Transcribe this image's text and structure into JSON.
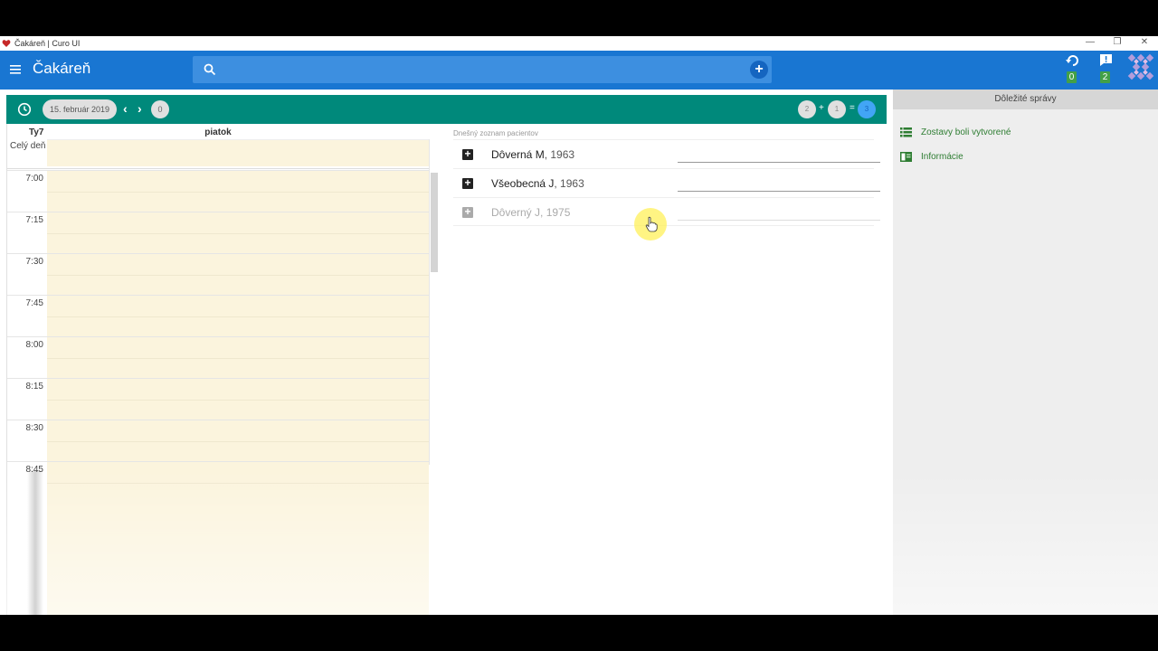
{
  "window": {
    "title": "Čakáreň | Curo UI"
  },
  "appbar": {
    "title": "Čakáreň",
    "search_placeholder": "",
    "sync_badge": "0",
    "messages_badge": "2"
  },
  "toolbar": {
    "date": "15. február 2019",
    "prev_label": "‹",
    "next_label": "›",
    "zero_chip": "0",
    "counts": {
      "a": "2",
      "b": "1",
      "total": "3"
    },
    "plus_op": "+",
    "equals_op": "="
  },
  "calendar": {
    "week_label": "Ty7",
    "day_label": "piatok",
    "allday_label": "Celý deň",
    "times": [
      "7:00",
      "7:15",
      "7:30",
      "7:45",
      "8:00",
      "8:15",
      "8:30",
      "8:45"
    ]
  },
  "patients": {
    "title": "Dnešný zoznam pacientov",
    "items": [
      {
        "name": "Dôverná M",
        "year": ", 1963"
      },
      {
        "name": "Všeobecná J",
        "year": ", 1963"
      },
      {
        "name": "Dôverný J",
        "year": ", 1975"
      }
    ]
  },
  "panel": {
    "title": "Dôležité správy",
    "items": [
      {
        "label": "Zostavy boli vytvorené",
        "icon": "list-icon"
      },
      {
        "label": "Informácie",
        "icon": "info-card-icon"
      }
    ]
  },
  "colors": {
    "appbar": "#1976d2",
    "toolbar": "#00897b",
    "calendar_bg": "#fbf4dd",
    "panel_link": "#2e7d32"
  }
}
